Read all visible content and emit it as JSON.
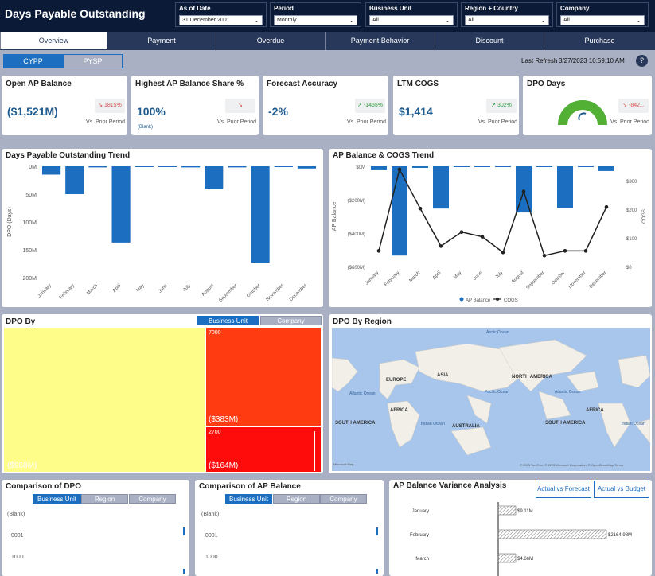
{
  "header": {
    "title": "Days Payable Outstanding",
    "filters": [
      {
        "label": "As of Date",
        "value": "31 December 2001"
      },
      {
        "label": "Period",
        "value": "Monthly"
      },
      {
        "label": "Business Unit",
        "value": "All"
      },
      {
        "label": "Region + Country",
        "value": "All"
      },
      {
        "label": "Company",
        "value": "All"
      }
    ]
  },
  "tabs": [
    "Overview",
    "Payment",
    "Overdue",
    "Payment Behavior",
    "Discount",
    "Purchase"
  ],
  "toggle": {
    "cypp": "CYPP",
    "pysp": "PYSP"
  },
  "refresh": {
    "label": "Last Refresh",
    "value": "3/27/2023 10:59:10 AM",
    "help": "?"
  },
  "kpis": [
    {
      "title": "Open AP Balance",
      "value": "($1,521M)",
      "badge": "↘ 1815%",
      "badge_color": "#d9534f",
      "sub": "Vs. Prior Period",
      "note": ""
    },
    {
      "title": "Highest AP Balance Share %",
      "value": "100%",
      "badge": "↘",
      "badge_color": "#d9534f",
      "sub": "Vs. Prior Period",
      "note": "(Blank)"
    },
    {
      "title": "Forecast Accuracy",
      "value": "-2%",
      "badge": "↗ -1455%",
      "badge_color": "#2e9a3e",
      "sub": "Vs. Prior Period",
      "note": ""
    },
    {
      "title": "LTM COGS",
      "value": "$1,414",
      "badge": "↗ 302%",
      "badge_color": "#2e9a3e",
      "sub": "Vs. Prior Period",
      "note": ""
    },
    {
      "title": "DPO Days",
      "value": "",
      "badge": "↘ -842...",
      "badge_color": "#d9534f",
      "sub": "Vs. Prior Period",
      "note": ""
    }
  ],
  "dpo_trend": {
    "title": "Days Payable Outstanding Trend",
    "chart_data": {
      "type": "bar",
      "categories": [
        "January",
        "February",
        "March",
        "April",
        "May",
        "June",
        "July",
        "August",
        "September",
        "October",
        "November",
        "December"
      ],
      "values": [
        -15,
        -50,
        -2,
        -137,
        -1,
        -1,
        -2,
        -40,
        -2,
        -173,
        -1,
        -4
      ],
      "ylabel": "DPO (Days)",
      "ytick_labels": [
        "0M",
        "50M",
        "100M",
        "150M",
        "200M"
      ],
      "ylim": [
        -200,
        0
      ]
    }
  },
  "ap_cogs": {
    "title": "AP Balance & COGS Trend",
    "chart_data": {
      "type": "bar",
      "categories": [
        "January",
        "February",
        "March",
        "April",
        "May",
        "June",
        "July",
        "August",
        "September",
        "October",
        "November",
        "December"
      ],
      "series": [
        {
          "name": "AP Balance",
          "type": "bar",
          "values": [
            -25,
            -570,
            -10,
            -270,
            -5,
            -5,
            -5,
            -295,
            -5,
            -265,
            -5,
            -30
          ]
        },
        {
          "name": "COGS",
          "type": "line",
          "values": [
            50,
            310,
            185,
            65,
            110,
            95,
            45,
            240,
            35,
            50,
            50,
            190
          ]
        }
      ],
      "ylabel": "AP Balance",
      "y2label": "COGS",
      "ytick_labels": [
        "$0M",
        "($200M)",
        "($400M)",
        "($600M)"
      ],
      "y2tick_labels": [
        "$300",
        "$200",
        "$100",
        "$0"
      ],
      "ylim": [
        -640,
        0
      ],
      "y2lim": [
        0,
        320
      ]
    }
  },
  "dpo_by": {
    "title": "DPO By",
    "buttons": [
      "Business Unit",
      "Company"
    ],
    "cells": [
      {
        "label": "",
        "value": "($968M)",
        "color": "#fffd8a"
      },
      {
        "label": "7000",
        "value": "($383M)",
        "color": "#ff3b12"
      },
      {
        "label": "2700",
        "value": "($164M)",
        "color": "#fe0b0b"
      }
    ]
  },
  "dpo_region": {
    "title": "DPO By Region",
    "labels": [
      "Arctic Ocean",
      "EUROPE",
      "ASIA",
      "NORTH AMERICA",
      "Atlantic Ocean",
      "Pacific Ocean",
      "Atlantic Ocean",
      "AFRICA",
      "AFRICA",
      "SOUTH AMERICA",
      "Indian Ocean",
      "AUSTRALIA",
      "SOUTH AMERICA",
      "Indian Ocean"
    ],
    "copyright": "© 2023 TomTom, © 2023 Microsoft Corporation, © OpenStreetMap  Terms",
    "brand": "Microsoft Bing"
  },
  "comp_dpo": {
    "title": "Comparison of DPO",
    "buttons": [
      "Business Unit",
      "Region",
      "Company"
    ],
    "rows": [
      "(Blank)",
      "0001",
      "1000"
    ]
  },
  "comp_ap": {
    "title": "Comparison of AP Balance",
    "buttons": [
      "Business Unit",
      "Region",
      "Company"
    ],
    "rows": [
      "(Blank)",
      "0001",
      "1000"
    ]
  },
  "variance": {
    "title": "AP Balance Variance Analysis",
    "buttons": [
      "Actual vs Forecast",
      "Actual vs Budget"
    ],
    "chart_data": {
      "type": "bar",
      "categories": [
        "January",
        "February",
        "March"
      ],
      "values": [
        -9.11,
        -2164.98,
        -4.66
      ],
      "data_labels": [
        "$9.11M",
        "$2164.98M",
        "$4.66M"
      ]
    }
  }
}
